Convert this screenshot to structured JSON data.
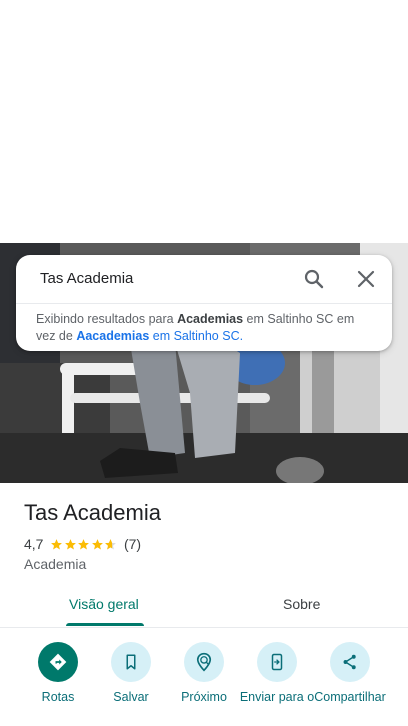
{
  "search": {
    "query": "Tas Academia",
    "hint_prefix": "Exibindo resultados para ",
    "hint_term": "Academias",
    "hint_mid": " em Saltinho SC em vez de ",
    "hint_alt_term": "Aacademias",
    "hint_alt_suffix": " em Saltinho SC."
  },
  "place": {
    "name": "Tas Academia",
    "rating": "4,7",
    "rating_value": 4.7,
    "review_count": "(7)",
    "category": "Academia"
  },
  "tabs": [
    {
      "label": "Visão geral",
      "active": true
    },
    {
      "label": "Sobre",
      "active": false
    }
  ],
  "actions": [
    {
      "label": "Rotas",
      "icon": "directions-icon"
    },
    {
      "label": "Salvar",
      "icon": "bookmark-icon"
    },
    {
      "label": "Próximo",
      "icon": "nearby-icon"
    },
    {
      "label": "Enviar para o",
      "icon": "send-to-phone-icon"
    },
    {
      "label": "Compartilhar",
      "icon": "share-icon"
    }
  ],
  "colors": {
    "accent": "#00796b",
    "action_bg": "#d6f0f7",
    "star": "#fbbc04",
    "link": "#1a73e8"
  }
}
